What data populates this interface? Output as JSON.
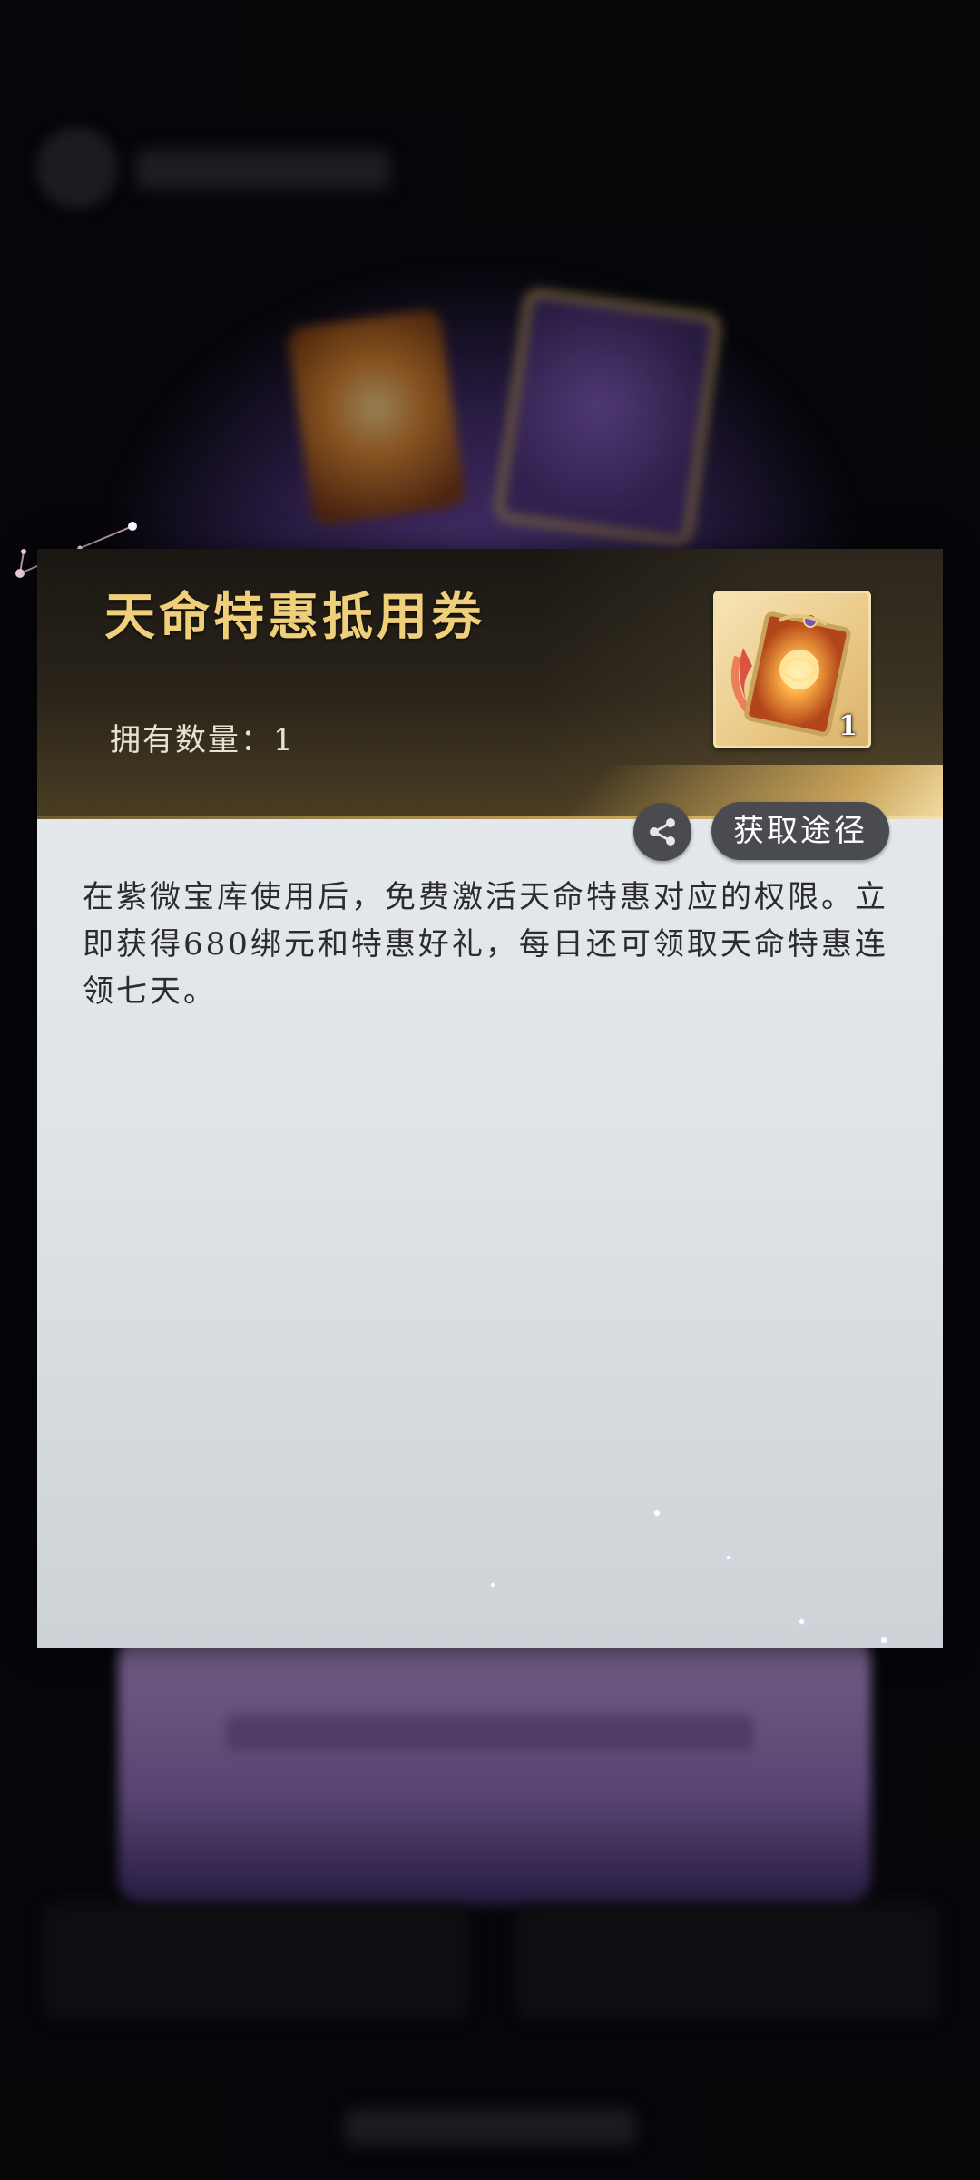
{
  "item": {
    "name": "天命特惠抵用券",
    "owned_label": "拥有数量：",
    "owned_count": "1",
    "icon_count": "1",
    "description": "在紫微宝库使用后，免费激活天命特惠对应的权限。立即获得680绑元和特惠好礼，每日还可领取天命特惠连领七天。"
  },
  "actions": {
    "obtain_label": "获取途径",
    "share_icon": "share-icon"
  },
  "colors": {
    "title_gold": "#f0cf7a",
    "header_dark": "#1a1713",
    "panel_light": "#e9ecf0",
    "button_gray": "#4a4b50"
  }
}
